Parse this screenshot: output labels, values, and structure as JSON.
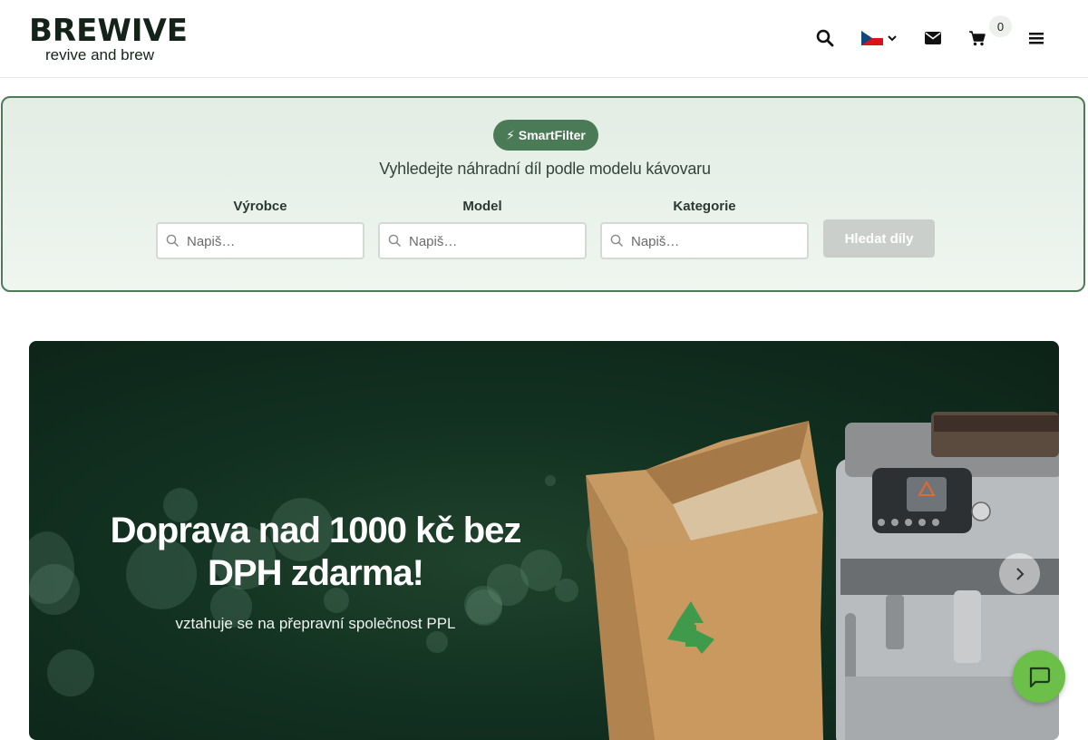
{
  "header": {
    "logo_word": "BREWIVE",
    "logo_tagline": "revive and brew",
    "icons": [
      "search-icon",
      "czech-flag-icon",
      "envelope-icon",
      "cart-icon",
      "menu-icon"
    ],
    "language": "CZ",
    "cart_count": "0"
  },
  "smartfilter": {
    "badge": "⚡ SmartFilter",
    "subtitle": "Vyhledejte náhradní díl podle modelu kávovaru",
    "fields": [
      {
        "label": "Výrobce",
        "placeholder": "Napiš…"
      },
      {
        "label": "Model",
        "placeholder": "Napiš…"
      },
      {
        "label": "Kategorie",
        "placeholder": "Napiš…"
      }
    ],
    "search_button": "Hledat díly",
    "border_color": "#4d7a58"
  },
  "hero": {
    "title": "Doprava nad 1000 kč bez DPH zdarma!",
    "subtitle": "vztahuje se na přepravní společnost PPL",
    "background_color": "#123121"
  },
  "colors": {
    "brand_green": "#4b7a56",
    "chat_green": "#6cc04a"
  }
}
